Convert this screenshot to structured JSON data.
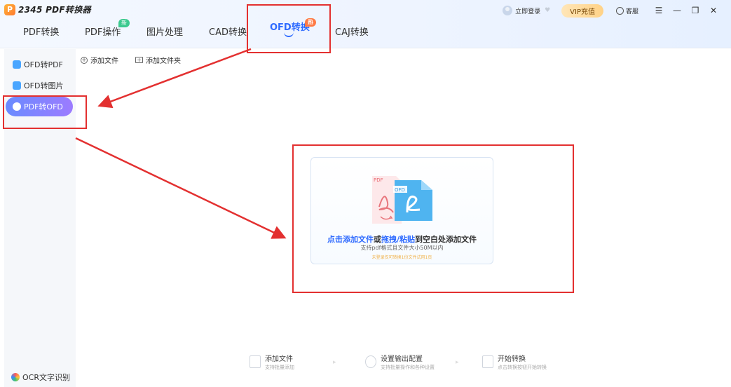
{
  "app": {
    "logo_letter": "P",
    "name": "2345 PDF转换器"
  },
  "header": {
    "tabs": [
      {
        "label": "PDF转换"
      },
      {
        "label": "PDF操作",
        "badge": "新"
      },
      {
        "label": "图片处理"
      },
      {
        "label": "CAD转换"
      },
      {
        "label": "OFD转换",
        "badge": "热",
        "active": true
      },
      {
        "label": "CAJ转换"
      }
    ],
    "login": "立即登录",
    "vip": "VIP充值",
    "service": "客服",
    "window_controls": {
      "menu": "☰",
      "minimize": "—",
      "maximize": "❐",
      "close": "✕"
    }
  },
  "sidebar": {
    "items": [
      {
        "label": "OFD转PDF"
      },
      {
        "label": "OFD转图片"
      },
      {
        "label": "PDF转OFD",
        "active": true
      }
    ],
    "ocr": "OCR文字识别"
  },
  "toolbar": {
    "add_file": "添加文件",
    "add_folder": "添加文件夹"
  },
  "dropzone": {
    "pdf_tag": "PDF",
    "ofd_tag": "OFD",
    "title_1": "点击添加文件",
    "title_2": "或",
    "title_3": "拖拽/粘贴",
    "title_4": "到空白处添加文件",
    "subtitle": "支持pdf格式且文件大小50M以内",
    "note": "未登录仅可转换1份文件试用1页"
  },
  "steps": [
    {
      "title": "添加文件",
      "desc": "支持批量添加"
    },
    {
      "title": "设置输出配置",
      "desc": "支持批量操作和各种设置"
    },
    {
      "title": "开始转换",
      "desc": "点击转换按钮开始转换"
    }
  ],
  "colors": {
    "accent": "#2f6bff",
    "annotation_red": "#e33030",
    "vip_gold": "#ffd287"
  }
}
